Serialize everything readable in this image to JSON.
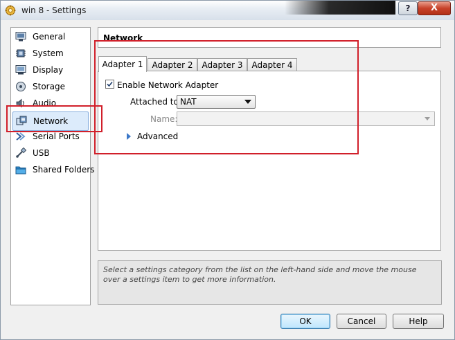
{
  "window": {
    "title": "win 8 - Settings",
    "help_button": "?",
    "close_button": "X"
  },
  "sidebar": {
    "items": [
      {
        "label": "General",
        "icon": "general-monitor-icon"
      },
      {
        "label": "System",
        "icon": "system-chip-icon"
      },
      {
        "label": "Display",
        "icon": "display-monitor-icon"
      },
      {
        "label": "Storage",
        "icon": "storage-disk-icon"
      },
      {
        "label": "Audio",
        "icon": "audio-speaker-icon"
      },
      {
        "label": "Network",
        "icon": "network-card-icon",
        "selected": true
      },
      {
        "label": "Serial Ports",
        "icon": "serial-port-icon"
      },
      {
        "label": "USB",
        "icon": "usb-plug-icon"
      },
      {
        "label": "Shared Folders",
        "icon": "shared-folder-icon"
      }
    ]
  },
  "panel": {
    "title": "Network",
    "tabs": [
      "Adapter 1",
      "Adapter 2",
      "Adapter 3",
      "Adapter 4"
    ],
    "active_tab": "Adapter 1",
    "enable_adapter": {
      "label": "Enable Network Adapter",
      "checked": true
    },
    "attached_to": {
      "label": "Attached to:",
      "value": "NAT"
    },
    "name": {
      "label": "Name:",
      "value": ""
    },
    "advanced": {
      "label": "Advanced"
    }
  },
  "info_text": "Select a settings category from the list on the left-hand side and move the mouse over a settings item to get more information.",
  "buttons": {
    "ok": "OK",
    "cancel": "Cancel",
    "help": "Help"
  },
  "colors": {
    "highlight": "#d11f2a",
    "selection": "#dcebfb"
  }
}
